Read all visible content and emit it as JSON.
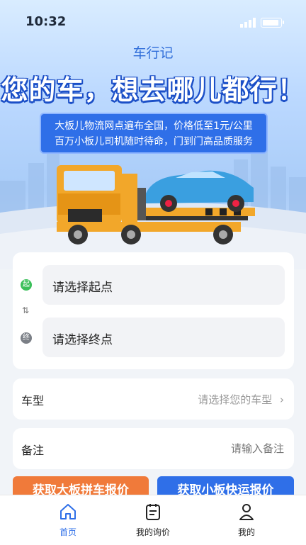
{
  "status_bar": {
    "time": "10:32"
  },
  "header": {
    "app_title": "车行记",
    "headline": "您的车，想去哪儿都行！",
    "promo_line1": "大板儿物流网点遍布全国，价格低至1元/公里",
    "promo_line2": "百万小板儿司机随时待命，门到门高品质服务"
  },
  "route": {
    "start_badge": "起",
    "end_badge": "终",
    "start_placeholder": "请选择起点",
    "end_placeholder": "请选择终点"
  },
  "vehicle_type": {
    "label": "车型",
    "placeholder": "请选择您的车型"
  },
  "remarks": {
    "label": "备注",
    "placeholder": "请输入备注"
  },
  "actions": {
    "big_board_quote": "获取大板拼车报价",
    "small_board_quote": "获取小板快运报价"
  },
  "tabbar": [
    {
      "label": "首页",
      "icon": "home-icon",
      "active": true
    },
    {
      "label": "我的询价",
      "icon": "quote-list-icon",
      "active": false
    },
    {
      "label": "我的",
      "icon": "user-icon",
      "active": false
    }
  ],
  "colors": {
    "primary": "#2f6fe8",
    "accent_orange": "#f07a3a",
    "start_green": "#3bbf5a",
    "end_gray": "#7b7f86"
  }
}
